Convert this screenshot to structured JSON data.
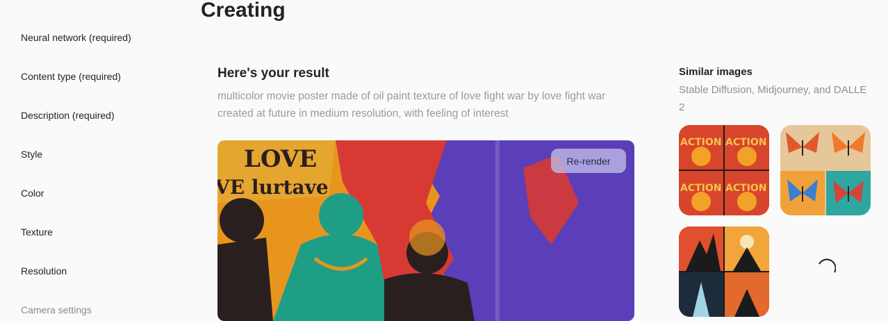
{
  "header": {
    "title": "Creating"
  },
  "sidebar": {
    "items": [
      {
        "label": "Neural network (required)"
      },
      {
        "label": "Content type (required)"
      },
      {
        "label": "Description (required)"
      },
      {
        "label": "Style"
      },
      {
        "label": "Color"
      },
      {
        "label": "Texture"
      },
      {
        "label": "Resolution"
      },
      {
        "label": "Camera settings"
      }
    ]
  },
  "result": {
    "heading": "Here's your result",
    "prompt": "multicolor movie poster made of oil paint texture of love fight war by love fight war created at future in medium resolution, with feeling of interest",
    "rerender_label": "Re-render",
    "image_text_1": "LOVE",
    "image_text_2": "VE lurtave"
  },
  "similar": {
    "heading": "Similar images",
    "subtitle": "Stable Diffusion, Midjourney, and DALLE 2",
    "thumb1_word": "ACTION"
  },
  "colors": {
    "accent_button": "#beb9e6",
    "poster_orange": "#e8951e",
    "poster_red": "#d73a33",
    "poster_purple": "#5a3fb8",
    "poster_teal": "#1f9e86"
  }
}
